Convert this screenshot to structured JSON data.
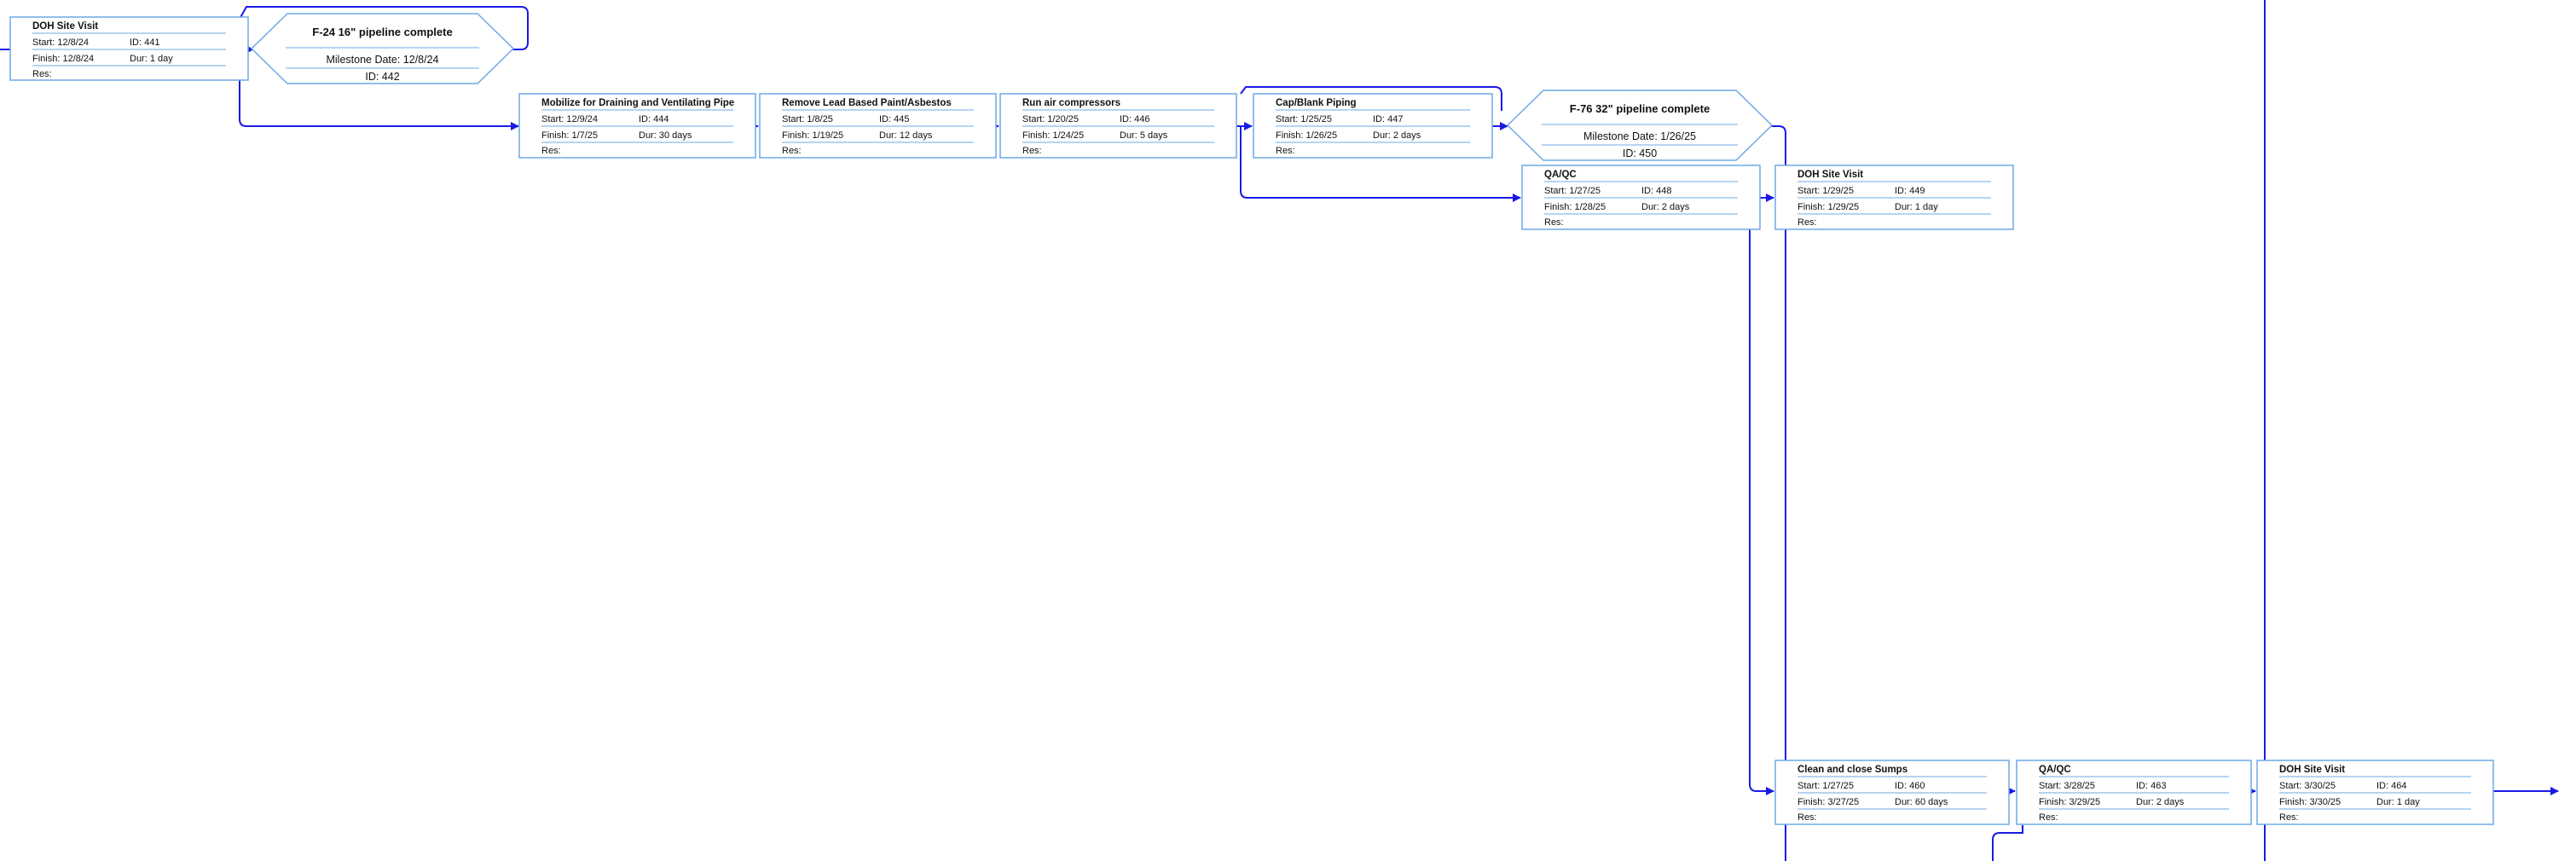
{
  "diagram": {
    "colors": {
      "connector": "#1a1ae6",
      "box_border": "#6ea8e6",
      "background": "#ffffff"
    },
    "tasks": [
      {
        "key": "t441",
        "name": "DOH Site Visit",
        "start": "Start:  12/8/24",
        "id": "ID:  441",
        "finish": "Finish: 12/8/24",
        "dur": "Dur: 1 day",
        "res": "Res:"
      },
      {
        "key": "t444",
        "name": "Mobilize for Draining and Ventilating Pipe",
        "start": "Start:  12/9/24",
        "id": "ID:  444",
        "finish": "Finish: 1/7/25",
        "dur": "Dur: 30 days",
        "res": "Res:"
      },
      {
        "key": "t445",
        "name": "Remove Lead Based Paint/Asbestos",
        "start": "Start:  1/8/25",
        "id": "ID:  445",
        "finish": "Finish: 1/19/25",
        "dur": "Dur: 12 days",
        "res": "Res:"
      },
      {
        "key": "t446",
        "name": "Run air compressors",
        "start": "Start:  1/20/25",
        "id": "ID:  446",
        "finish": "Finish: 1/24/25",
        "dur": "Dur: 5 days",
        "res": "Res:"
      },
      {
        "key": "t447",
        "name": "Cap/Blank Piping",
        "start": "Start:  1/25/25",
        "id": "ID:  447",
        "finish": "Finish: 1/26/25",
        "dur": "Dur: 2 days",
        "res": "Res:"
      },
      {
        "key": "t448",
        "name": "QA/QC",
        "start": "Start:  1/27/25",
        "id": "ID:  448",
        "finish": "Finish: 1/28/25",
        "dur": "Dur: 2 days",
        "res": "Res:"
      },
      {
        "key": "t449",
        "name": "DOH Site Visit",
        "start": "Start:  1/29/25",
        "id": "ID:  449",
        "finish": "Finish: 1/29/25",
        "dur": "Dur: 1 day",
        "res": "Res:"
      },
      {
        "key": "t460",
        "name": "Clean and close Sumps",
        "start": "Start:  1/27/25",
        "id": "ID:  460",
        "finish": "Finish: 3/27/25",
        "dur": "Dur: 60 days",
        "res": "Res:"
      },
      {
        "key": "t463",
        "name": "QA/QC",
        "start": "Start:  3/28/25",
        "id": "ID:  463",
        "finish": "Finish: 3/29/25",
        "dur": "Dur: 2 days",
        "res": "Res:"
      },
      {
        "key": "t464",
        "name": "DOH Site Visit",
        "start": "Start:  3/30/25",
        "id": "ID:  464",
        "finish": "Finish: 3/30/25",
        "dur": "Dur: 1 day",
        "res": "Res:"
      }
    ],
    "milestones": [
      {
        "key": "m442",
        "name": "F-24 16\" pipeline complete",
        "date": "Milestone Date: 12/8/24",
        "id": "ID: 442"
      },
      {
        "key": "m450",
        "name": "F-76 32\" pipeline complete",
        "date": "Milestone Date: 1/26/25",
        "id": "ID: 450"
      }
    ]
  }
}
